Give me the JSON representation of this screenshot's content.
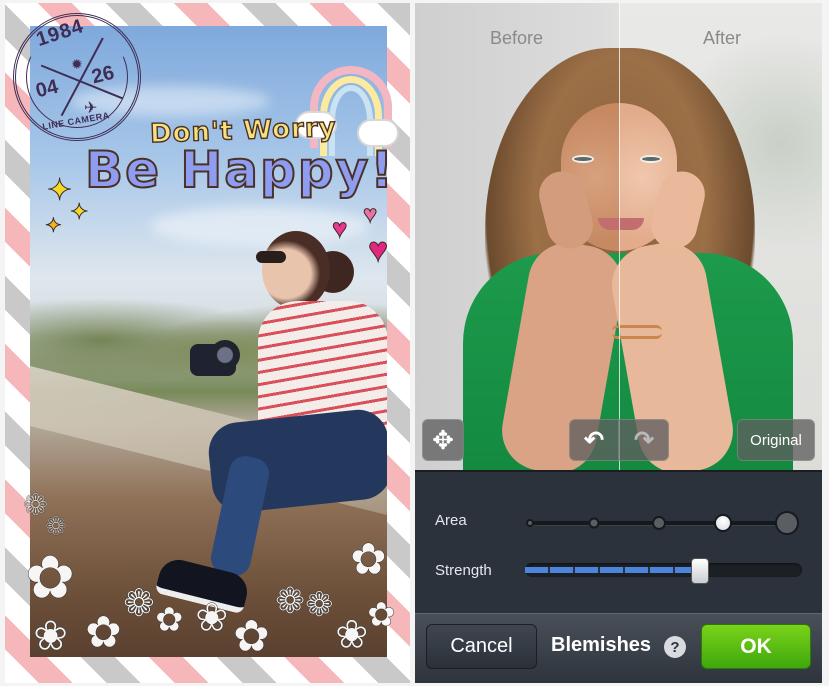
{
  "left_screen": {
    "stamp": {
      "year": "1984",
      "month": "04",
      "day": "26",
      "brand": "LINE CAMERA"
    },
    "stickers": {
      "top_text": "Don't Worry",
      "main_text": "Be Happy!"
    }
  },
  "right_screen": {
    "preview": {
      "before_label": "Before",
      "after_label": "After"
    },
    "toolbar": {
      "move_icon": "✥",
      "undo_icon": "↶",
      "redo_icon": "↷",
      "original_label": "Original"
    },
    "controls": {
      "area": {
        "label": "Area",
        "levels": 5,
        "selected_level": 4
      },
      "strength": {
        "label": "Strength",
        "value_fraction": 0.63
      }
    },
    "bottom_bar": {
      "cancel_label": "Cancel",
      "mode_title": "Blemishes",
      "help_icon": "?",
      "ok_label": "OK"
    },
    "colors": {
      "ok_green": "#5cbf12",
      "slider_blue": "#4b86da",
      "panel_dark": "#2b323b"
    }
  }
}
